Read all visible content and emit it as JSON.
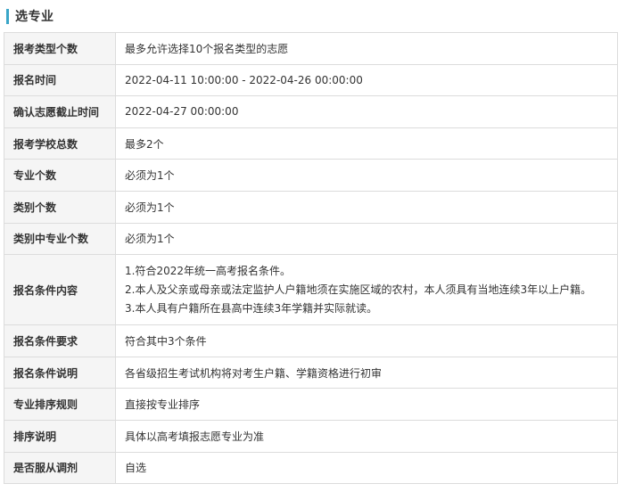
{
  "section": {
    "title": "选专业"
  },
  "rows": [
    {
      "label": "报考类型个数",
      "value": "最多允许选择10个报名类型的志愿"
    },
    {
      "label": "报名时间",
      "value": "2022-04-11 10:00:00 - 2022-04-26 00:00:00"
    },
    {
      "label": "确认志愿截止时间",
      "value": "2022-04-27 00:00:00"
    },
    {
      "label": "报考学校总数",
      "value": "最多2个"
    },
    {
      "label": "专业个数",
      "value": "必须为1个"
    },
    {
      "label": "类别个数",
      "value": "必须为1个"
    },
    {
      "label": "类别中专业个数",
      "value": "必须为1个"
    },
    {
      "label": "报名条件内容",
      "lines": [
        "1.符合2022年统一高考报名条件。",
        "2.本人及父亲或母亲或法定监护人户籍地须在实施区域的农村，本人须具有当地连续3年以上户籍。",
        "3.本人具有户籍所在县高中连续3年学籍并实际就读。"
      ]
    },
    {
      "label": "报名条件要求",
      "value": "符合其中3个条件"
    },
    {
      "label": "报名条件说明",
      "value": "各省级招生考试机构将对考生户籍、学籍资格进行初审"
    },
    {
      "label": "专业排序规则",
      "value": "直接按专业排序"
    },
    {
      "label": "排序说明",
      "value": "具体以高考填报志愿专业为准"
    },
    {
      "label": "是否服从调剂",
      "value": "自选"
    }
  ]
}
